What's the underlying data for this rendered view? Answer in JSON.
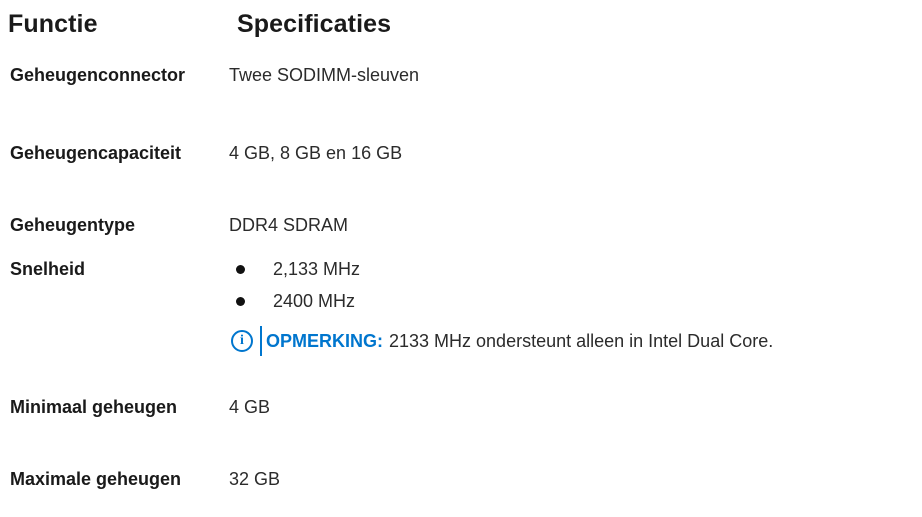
{
  "headers": {
    "function": "Functie",
    "specifications": "Specificaties"
  },
  "rows": [
    {
      "label": "Geheugenconnector",
      "value": "Twee SODIMM-sleuven"
    },
    {
      "label": "Geheugencapaciteit",
      "value": "4 GB, 8 GB en 16 GB"
    },
    {
      "label": "Geheugentype",
      "value": "DDR4 SDRAM"
    },
    {
      "label": "Snelheid",
      "bullets": [
        "2,133 MHz",
        "2400 MHz"
      ]
    },
    {
      "label": "Minimaal geheugen",
      "value": "4 GB"
    },
    {
      "label": "Maximale geheugen",
      "value": "32 GB"
    }
  ],
  "note": {
    "icon": "info-icon",
    "title": "OPMERKING:",
    "text": "2133 MHz ondersteunt alleen in Intel Dual Core."
  },
  "colors": {
    "accent": "#0076ce",
    "text": "#222222"
  }
}
